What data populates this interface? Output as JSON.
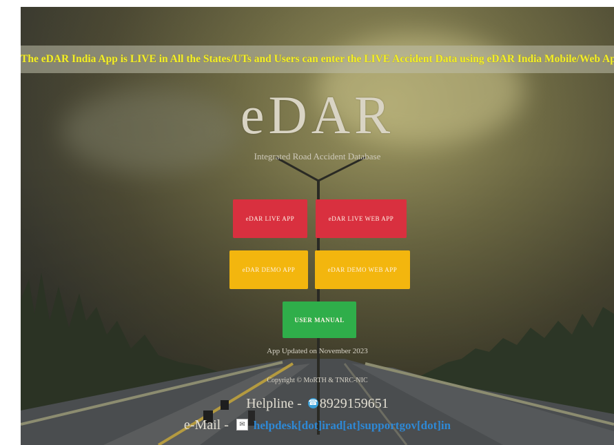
{
  "banner": {
    "text": "The eDAR India App is LIVE in All the States/UTs and Users can enter the LIVE Accident Data using eDAR India Mobile/Web App."
  },
  "logo": {
    "text": "eDAR"
  },
  "tagline": "Integrated Road Accident Database",
  "buttons": {
    "live_app": "eDAR LIVE APP",
    "live_web_app": "eDAR LIVE WEB APP",
    "demo_app": "eDAR DEMO APP",
    "demo_web_app": "eDAR DEMO WEB APP",
    "user_manual": "USER MANUAL"
  },
  "app_updated": "App Updated on November 2023",
  "copyright": "Copyright © MoRTH & TNRC-NIC",
  "helpline": {
    "label": "Helpline - ",
    "number": "8929159651"
  },
  "email": {
    "label": "e-Mail - ",
    "address": "helpdesk[dot]irad[at]supportgov[dot]in"
  },
  "colors": {
    "banner_text": "#f3ef2a",
    "live_buttons": "#d9303f",
    "demo_buttons": "#f3b60e",
    "manual_button": "#2fae4a",
    "email_link": "#2e89d6"
  },
  "icons": {
    "phone": "phone-icon",
    "mail": "mail-icon"
  }
}
